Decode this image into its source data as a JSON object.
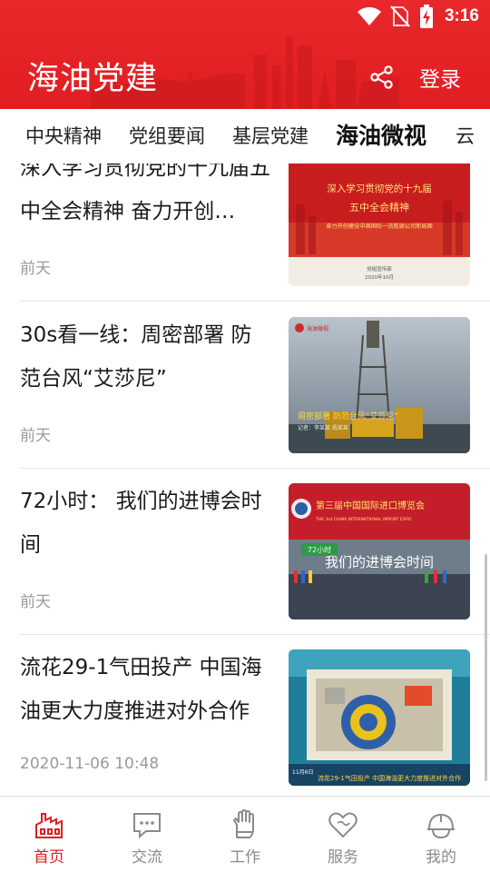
{
  "status_bar": {
    "time": "3:16",
    "icons": [
      "wifi-icon",
      "no-sim-icon",
      "battery-charging-icon"
    ]
  },
  "header": {
    "title": "海油党建",
    "login_label": "登录",
    "share_icon": "share-icon",
    "color": "#e11e22"
  },
  "tabs": [
    {
      "label": "中央精神",
      "active": false
    },
    {
      "label": "党组要闻",
      "active": false
    },
    {
      "label": "基层党建",
      "active": false
    },
    {
      "label": "海油微视",
      "active": true
    },
    {
      "label": "云",
      "active": false
    }
  ],
  "articles": [
    {
      "title": "深入学习贯彻党的十九届五中全会精神 奋力开创…",
      "time": "前天",
      "thumb": {
        "line1": "深入学习贯彻党的十九届",
        "line2": "五中全会精神",
        "line3": "奋力开创建设中国国际一流能源公司新局面",
        "footer1": "党组宣传部",
        "footer2": "2020年10月"
      }
    },
    {
      "title": "30s看一线：周密部署 防范台风“艾莎尼”",
      "time": "前天",
      "thumb": {
        "logo": "海油微视",
        "caption": "周密部署 防范台风“艾莎尼”",
        "sub": "记者：李某某 杨某某"
      }
    },
    {
      "title": "72小时： 我们的进博会时间",
      "time": "前天",
      "thumb": {
        "banner": "第三届中国国际进口博览会",
        "banner_en": "THE 3rd CHINA INTERNATIONAL IMPORT EXPO",
        "tag": "72小时",
        "caption": "我们的进博会时间"
      }
    },
    {
      "title": "流花29-1气田投产 中国海油更大力度推进对外合作",
      "time": "2020-11-06 10:48",
      "thumb": {
        "date": "11月6日",
        "caption": "流花29-1气田投产 中国海油更大力度推进对外合作"
      }
    }
  ],
  "bottom_nav": [
    {
      "label": "首页",
      "icon": "home-icon",
      "active": true
    },
    {
      "label": "交流",
      "icon": "chat-icon",
      "active": false
    },
    {
      "label": "工作",
      "icon": "work-glove-icon",
      "active": false
    },
    {
      "label": "服务",
      "icon": "heart-icon",
      "active": false
    },
    {
      "label": "我的",
      "icon": "helmet-icon",
      "active": false
    }
  ],
  "colors": {
    "accent": "#e11e22",
    "gray_text": "#9a9a9a",
    "nav_inactive": "#8a8a8a"
  }
}
